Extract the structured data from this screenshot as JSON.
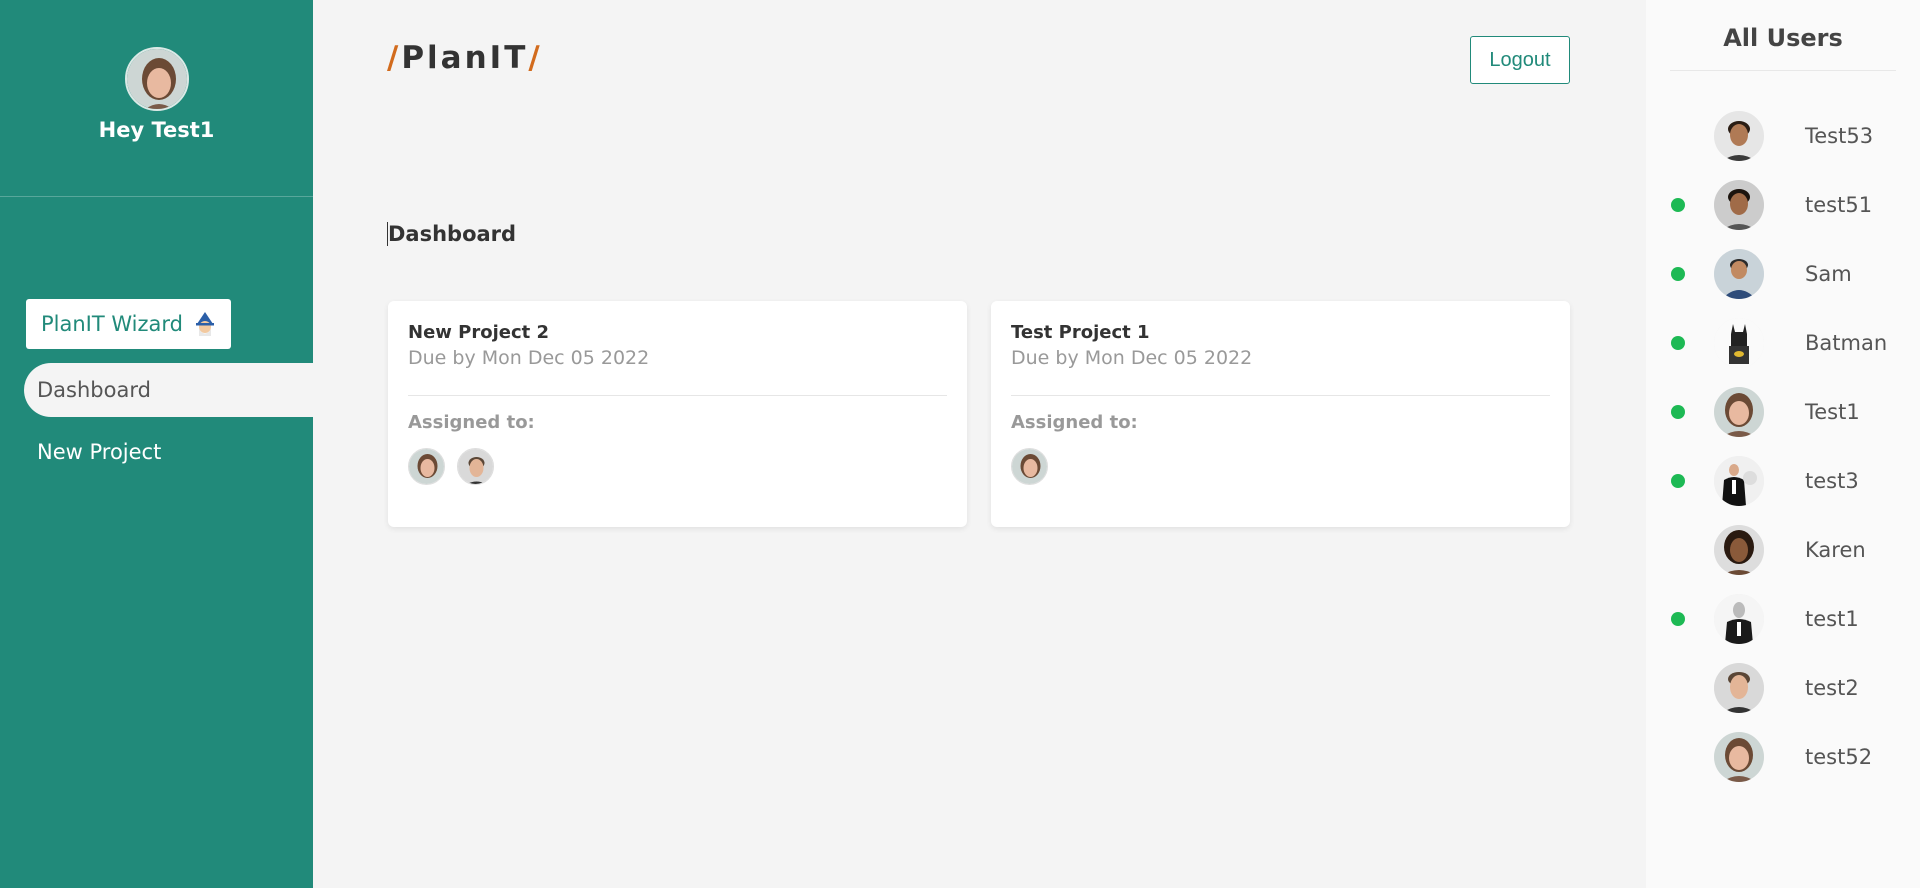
{
  "sidebar": {
    "greeting": "Hey Test1",
    "wizard_label": "PlanIT Wizard",
    "nav": [
      {
        "label": "Dashboard",
        "active": true
      },
      {
        "label": "New Project",
        "active": false
      }
    ]
  },
  "header": {
    "logo_text": "PlanIT",
    "logout_label": "Logout"
  },
  "main": {
    "title": "Dashboard",
    "projects": [
      {
        "title": "New Project 2",
        "due": "Due by Mon Dec 05 2022",
        "assigned_label": "Assigned to:",
        "assignee_count": 2
      },
      {
        "title": "Test Project 1",
        "due": "Due by Mon Dec 05 2022",
        "assigned_label": "Assigned to:",
        "assignee_count": 1
      }
    ]
  },
  "users_panel": {
    "title": "All Users",
    "users": [
      {
        "name": "Test53",
        "online": false
      },
      {
        "name": "test51",
        "online": true
      },
      {
        "name": "Sam",
        "online": true
      },
      {
        "name": "Batman",
        "online": true
      },
      {
        "name": "Test1",
        "online": true
      },
      {
        "name": "test3",
        "online": true
      },
      {
        "name": "Karen",
        "online": false
      },
      {
        "name": "test1",
        "online": true
      },
      {
        "name": "test2",
        "online": false
      },
      {
        "name": "test52",
        "online": false
      }
    ]
  },
  "colors": {
    "sidebar": "#218a7a",
    "accent": "#d26b1d",
    "online": "#1db954"
  }
}
